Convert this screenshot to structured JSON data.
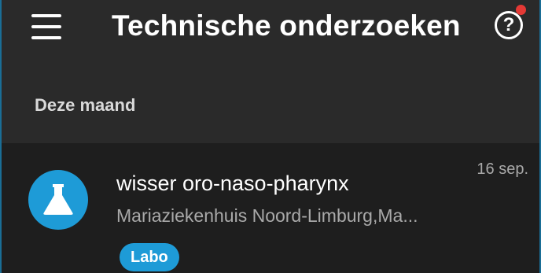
{
  "appbar": {
    "title": "Technische onderzoeken",
    "menu_icon": "menu-icon",
    "help_icon": "help-circle-icon",
    "help_glyph": "?",
    "notification_color": "#e53935"
  },
  "section": {
    "label": "Deze maand"
  },
  "items": [
    {
      "icon": "flask-icon",
      "title": "wisser oro-naso-pharynx",
      "subtitle": "Mariaziekenhuis Noord-Limburg,Ma...",
      "date": "16 sep.",
      "tag": "Labo"
    }
  ],
  "colors": {
    "accent": "#1e9bd7",
    "background": "#2a2a2a",
    "item_background": "#1e1e1e"
  }
}
